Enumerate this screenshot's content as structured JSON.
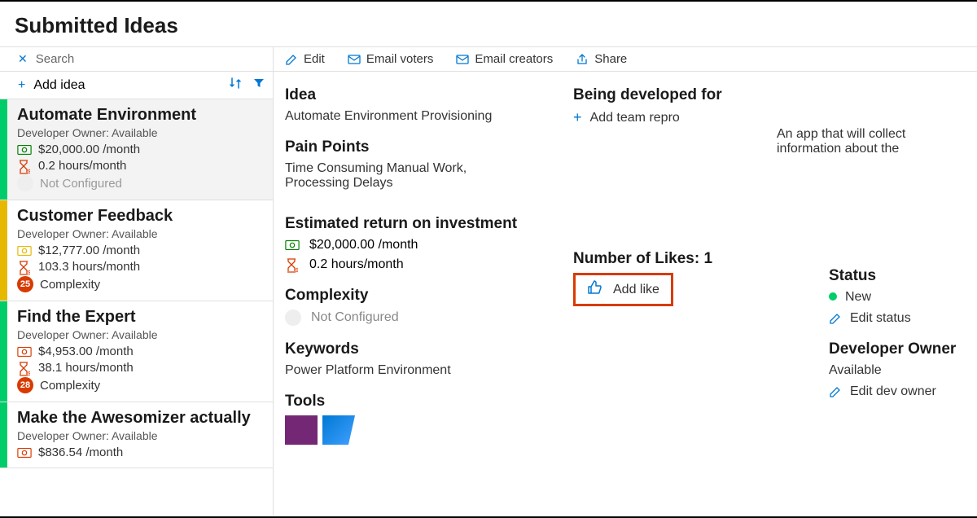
{
  "header": {
    "title": "Submitted Ideas"
  },
  "sidebar": {
    "search_placeholder": "Search",
    "add_label": "Add idea",
    "items": [
      {
        "title": "Automate Environment",
        "owner": "Developer Owner: Available",
        "money": "$20,000.00 /month",
        "money_color": "green",
        "hours": "0.2 hours/month",
        "complexity": "Not Configured",
        "badge": "",
        "badge_gray": true,
        "color": "green",
        "selected": true
      },
      {
        "title": "Customer Feedback",
        "owner": "Developer Owner: Available",
        "money": "$12,777.00 /month",
        "money_color": "yellow",
        "hours": "103.3 hours/month",
        "complexity": "Complexity",
        "badge": "25",
        "badge_gray": false,
        "color": "yellow",
        "selected": false
      },
      {
        "title": "Find the Expert",
        "owner": "Developer Owner: Available",
        "money": "$4,953.00 /month",
        "money_color": "red",
        "hours": "38.1 hours/month",
        "complexity": "Complexity",
        "badge": "28",
        "badge_gray": false,
        "color": "green",
        "selected": false
      },
      {
        "title": "Make the Awesomizer actually",
        "owner": "Developer Owner: Available",
        "money": "$836.54 /month",
        "money_color": "red",
        "hours": "",
        "complexity": "",
        "badge": "",
        "badge_gray": false,
        "color": "green",
        "selected": false
      }
    ]
  },
  "toolbar": {
    "edit": "Edit",
    "email_voters": "Email voters",
    "email_creators": "Email creators",
    "share": "Share"
  },
  "detail": {
    "idea_label": "Idea",
    "idea_value": "Automate Environment Provisioning",
    "developed_for_label": "Being developed for",
    "add_team_repro": "Add team repro",
    "description": "An app that will collect information about the",
    "pain_label": "Pain Points",
    "pain_value": "Time Consuming Manual Work, Processing Delays",
    "roi_label": "Estimated return on investment",
    "roi_money": "$20,000.00 /month",
    "roi_hours": "0.2 hours/month",
    "likes_label": "Number of Likes: 1",
    "add_like": "Add like",
    "complexity_label": "Complexity",
    "complexity_value": "Not Configured",
    "status_label": "Status",
    "status_value": "New",
    "edit_status": "Edit status",
    "dev_owner_label": "Developer Owner",
    "dev_owner_value": "Available",
    "edit_dev_owner": "Edit dev owner",
    "keywords_label": "Keywords",
    "keywords_value": "Power Platform Environment",
    "tools_label": "Tools"
  }
}
